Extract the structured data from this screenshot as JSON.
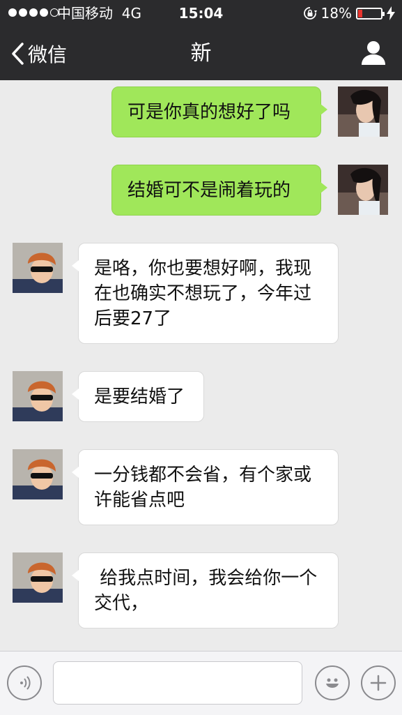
{
  "status_bar": {
    "carrier": "中国移动",
    "network": "4G",
    "time": "15:04",
    "battery_text": "18%",
    "battery_level": 0.18,
    "battery_color": "#e8352e"
  },
  "nav": {
    "back_label": "微信",
    "title": "新"
  },
  "messages": [
    {
      "side": "out",
      "text": "可是你真的想好了吗"
    },
    {
      "side": "out",
      "text": "结婚可不是闹着玩的"
    },
    {
      "side": "in",
      "text": "是咯，你也要想好啊，我现在也确实不想玩了，今年过后要27了"
    },
    {
      "side": "in",
      "text": "是要结婚了"
    },
    {
      "side": "in",
      "text": "一分钱都不会省，有个家或许能省点吧"
    },
    {
      "side": "in",
      "text": " 给我点时间，我会给你一个交代，"
    }
  ],
  "input": {
    "value": "",
    "placeholder": ""
  },
  "colors": {
    "outgoing_bubble": "#a0e75a",
    "incoming_bubble": "#ffffff",
    "nav_background": "#2b2b2d"
  },
  "icons": [
    "back-chevron-icon",
    "profile-icon",
    "voice-icon",
    "emoji-icon",
    "plus-icon",
    "lock-rotation-icon",
    "charging-icon"
  ]
}
